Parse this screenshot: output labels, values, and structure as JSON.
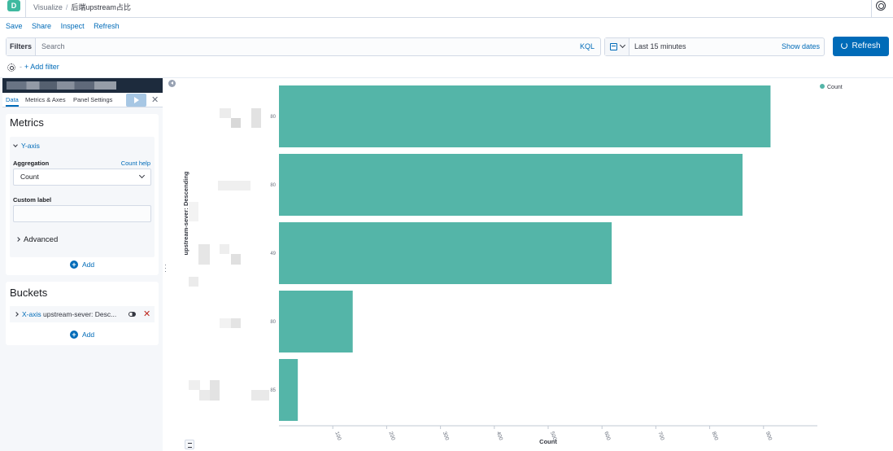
{
  "app": {
    "logo_letter": "D",
    "breadcrumbs": [
      "Visualize",
      "后端upstream占比"
    ],
    "breadcrumb_sep": "/"
  },
  "menu": [
    "Save",
    "Share",
    "Inspect",
    "Refresh"
  ],
  "query": {
    "filters_label": "Filters",
    "search_placeholder": "Search",
    "kql_label": "KQL"
  },
  "time": {
    "range": "Last 15 minutes",
    "show_dates": "Show dates",
    "refresh_label": "Refresh"
  },
  "filterbar": {
    "add_filter": "+ Add filter",
    "dash": "-"
  },
  "editor": {
    "tabs": [
      "Data",
      "Metrics & Axes",
      "Panel Settings"
    ],
    "metrics_title": "Metrics",
    "y_axis_label": "Y-axis",
    "aggregation_label": "Aggregation",
    "count_help": "Count help",
    "aggregation_value": "Count",
    "custom_label": "Custom label",
    "custom_label_value": "",
    "advanced": "Advanced",
    "add": "Add",
    "buckets_title": "Buckets",
    "bucket_axis": "X-axis",
    "bucket_desc": "upstream-sever: Desc..."
  },
  "colors": {
    "bar": "#54b5a8",
    "accent": "#006bb8",
    "header_dark": "#1d2b3d"
  },
  "chart_data": {
    "type": "bar",
    "orientation": "horizontal",
    "categories": [
      "80",
      "80",
      "49",
      "80",
      "85"
    ],
    "values": [
      913,
      861,
      618,
      137,
      35
    ],
    "xlabel": "Count",
    "ylabel": "upstream-sever: Descending",
    "xlim": [
      0,
      1000
    ],
    "xticks": [
      100,
      200,
      300,
      400,
      500,
      600,
      700,
      800,
      900
    ],
    "legend": [
      {
        "name": "Count",
        "color": "#54b5a8"
      }
    ],
    "legend_position": "top-right",
    "grid": false
  }
}
